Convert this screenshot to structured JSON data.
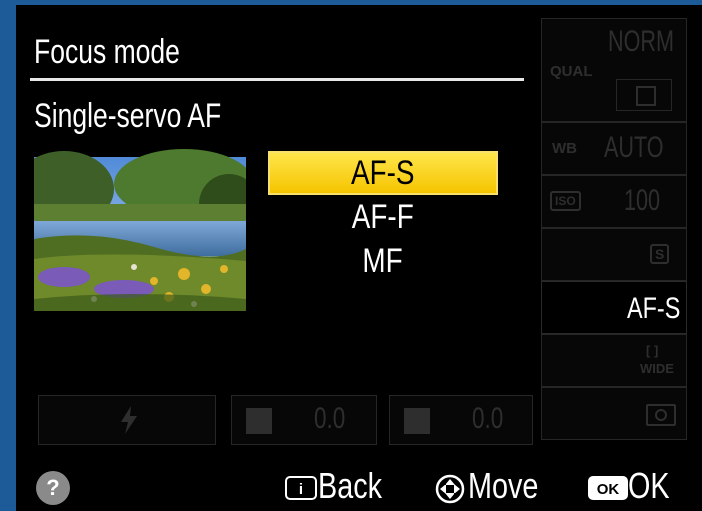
{
  "menu": {
    "title": "Focus mode",
    "current_setting": "Single-servo AF",
    "options": [
      {
        "label": "AF-S",
        "selected": true
      },
      {
        "label": "AF-F",
        "selected": false
      },
      {
        "label": "MF",
        "selected": false
      }
    ],
    "preview_image": "landscape-lake-photo"
  },
  "info_panel": {
    "quality_label": "QUAL",
    "quality_value": "NORM",
    "wb_label": "WB",
    "wb_value": "AUTO",
    "iso_label": "ISO",
    "iso_value": "100",
    "release_mode": "S",
    "focus_mode": "AF-S",
    "af_area_top": "[ ]",
    "af_area_bottom": "WIDE",
    "flash_comp": "0.0",
    "exposure_comp": "0.0"
  },
  "footer": {
    "help_label": "?",
    "back_key": "i",
    "back_label": "Back",
    "move_label": "Move",
    "ok_key": "OK",
    "ok_label": "OK"
  },
  "colors": {
    "background": "#1d5a98",
    "highlight": "#f5c400",
    "text": "#ffffff"
  }
}
